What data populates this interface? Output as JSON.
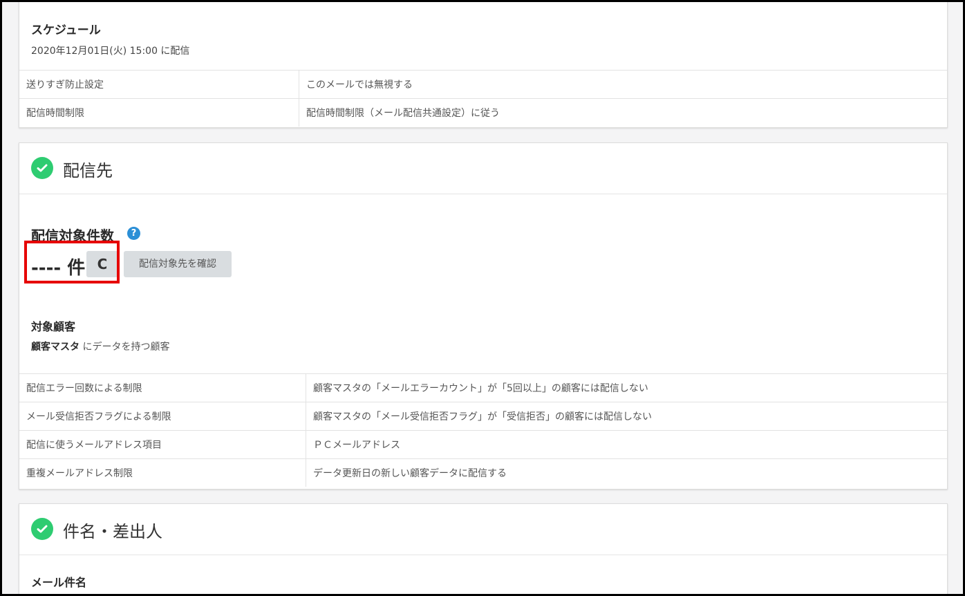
{
  "schedule": {
    "title": "スケジュール",
    "value": "2020年12月01日(火) 15:00 に配信",
    "rows": [
      {
        "key": "送りすぎ防止設定",
        "value": "このメールでは無視する"
      },
      {
        "key": "配信時間制限",
        "value": "配信時間制限（メール配信共通設定）に従う"
      }
    ]
  },
  "recipients": {
    "title": "配信先",
    "count_label": "配信対象件数",
    "help_glyph": "?",
    "count_value": "---- 件",
    "refresh_glyph": "C",
    "confirm_button": "配信対象先を確認",
    "target_title": "対象顧客",
    "target_master": "顧客マスタ",
    "target_suffix": " にデータを持つ顧客",
    "rows": [
      {
        "key": "配信エラー回数による制限",
        "value": "顧客マスタの「メールエラーカウント」が「5回以上」の顧客には配信しない"
      },
      {
        "key": "メール受信拒否フラグによる制限",
        "value": "顧客マスタの「メール受信拒否フラグ」が「受信拒否」の顧客には配信しない"
      },
      {
        "key": "配信に使うメールアドレス項目",
        "value": "ＰＣメールアドレス"
      },
      {
        "key": "重複メールアドレス制限",
        "value": "データ更新日の新しい顧客データに配信する"
      }
    ]
  },
  "subject": {
    "title": "件名・差出人",
    "mail_subject_label": "メール件名"
  },
  "colors": {
    "check": "#2ecc71",
    "help": "#2b8fd6",
    "highlight": "#e60000",
    "button_bg": "#d9dde0"
  },
  "icons": [
    "check-circle-icon",
    "help-icon",
    "refresh-icon"
  ]
}
